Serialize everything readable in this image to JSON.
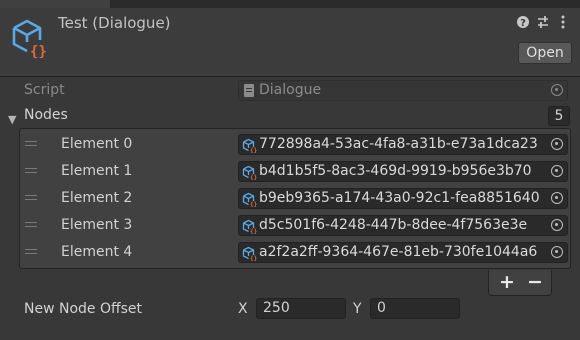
{
  "header": {
    "title": "Test (Dialogue)",
    "icons": [
      "help-icon",
      "preset-sliders-icon",
      "more-menu-icon"
    ],
    "open_label": "Open",
    "asset_icon": "scriptable-object-cube-icon"
  },
  "script_row": {
    "label": "Script",
    "value": "Dialogue"
  },
  "nodes": {
    "label": "Nodes",
    "count": "5",
    "elements": [
      {
        "label": "Element 0",
        "value": "772898a4-53ac-4fa8-a31b-e73a1dca23"
      },
      {
        "label": "Element 1",
        "value": "b4d1b5f5-8ac3-469d-9919-b956e3b70"
      },
      {
        "label": "Element 2",
        "value": "b9eb9365-a174-43a0-92c1-fea8851640"
      },
      {
        "label": "Element 3",
        "value": "d5c501f6-4248-447b-8dee-4f7563e3e"
      },
      {
        "label": "Element 4",
        "value": "a2f2a2ff-9364-467e-81eb-730fe1044a6"
      }
    ],
    "add_label": "+",
    "remove_label": "−"
  },
  "offset": {
    "label": "New Node Offset",
    "x_label": "X",
    "x_value": "250",
    "y_label": "Y",
    "y_value": "0"
  },
  "colors": {
    "background": "#383838",
    "field": "#2a2a2a",
    "icon_blue": "#5aa9e6",
    "icon_orange": "#e06a3b"
  }
}
